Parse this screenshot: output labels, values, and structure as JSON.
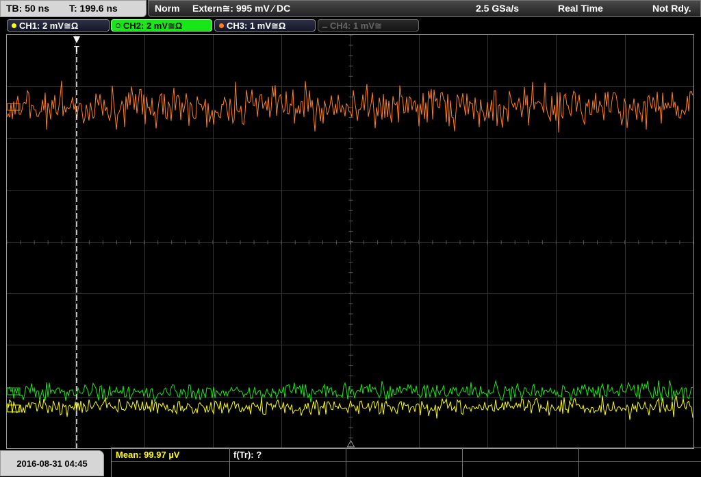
{
  "header": {
    "timebase": "TB: 50 ns",
    "trigger_time": "T: 199.6 ns",
    "mode": "Norm",
    "trigger_source": "Extern≅: 995 mV ⁄ DC",
    "sample_rate": "2.5 GSa/s",
    "acq_mode": "Real Time",
    "status": "Not Rdy."
  },
  "channels": [
    {
      "label": "CH1: 2 mV≅Ω",
      "color": "#ffff00",
      "active": false,
      "enabled": true
    },
    {
      "label": "CH2: 2 mV≅Ω",
      "color": "#19e619",
      "active": true,
      "enabled": true
    },
    {
      "label": "CH3: 1 mV≅Ω",
      "color": "#ff7f1e",
      "active": false,
      "enabled": true
    },
    {
      "label": "CH4: 1 mV≅",
      "color": "#666666",
      "active": false,
      "enabled": false
    }
  ],
  "trigger_marker": "T",
  "measurements": {
    "mean": "Mean: 99.97 µV",
    "freq": "f(Tr): ?"
  },
  "footer": {
    "datetime": "2016-08-31 04:45"
  },
  "colors": {
    "grid": "#333333",
    "ch1": "#ffff00",
    "ch2": "#19e619",
    "ch3": "#ff7f1e",
    "trigger": "#ffffff"
  }
}
